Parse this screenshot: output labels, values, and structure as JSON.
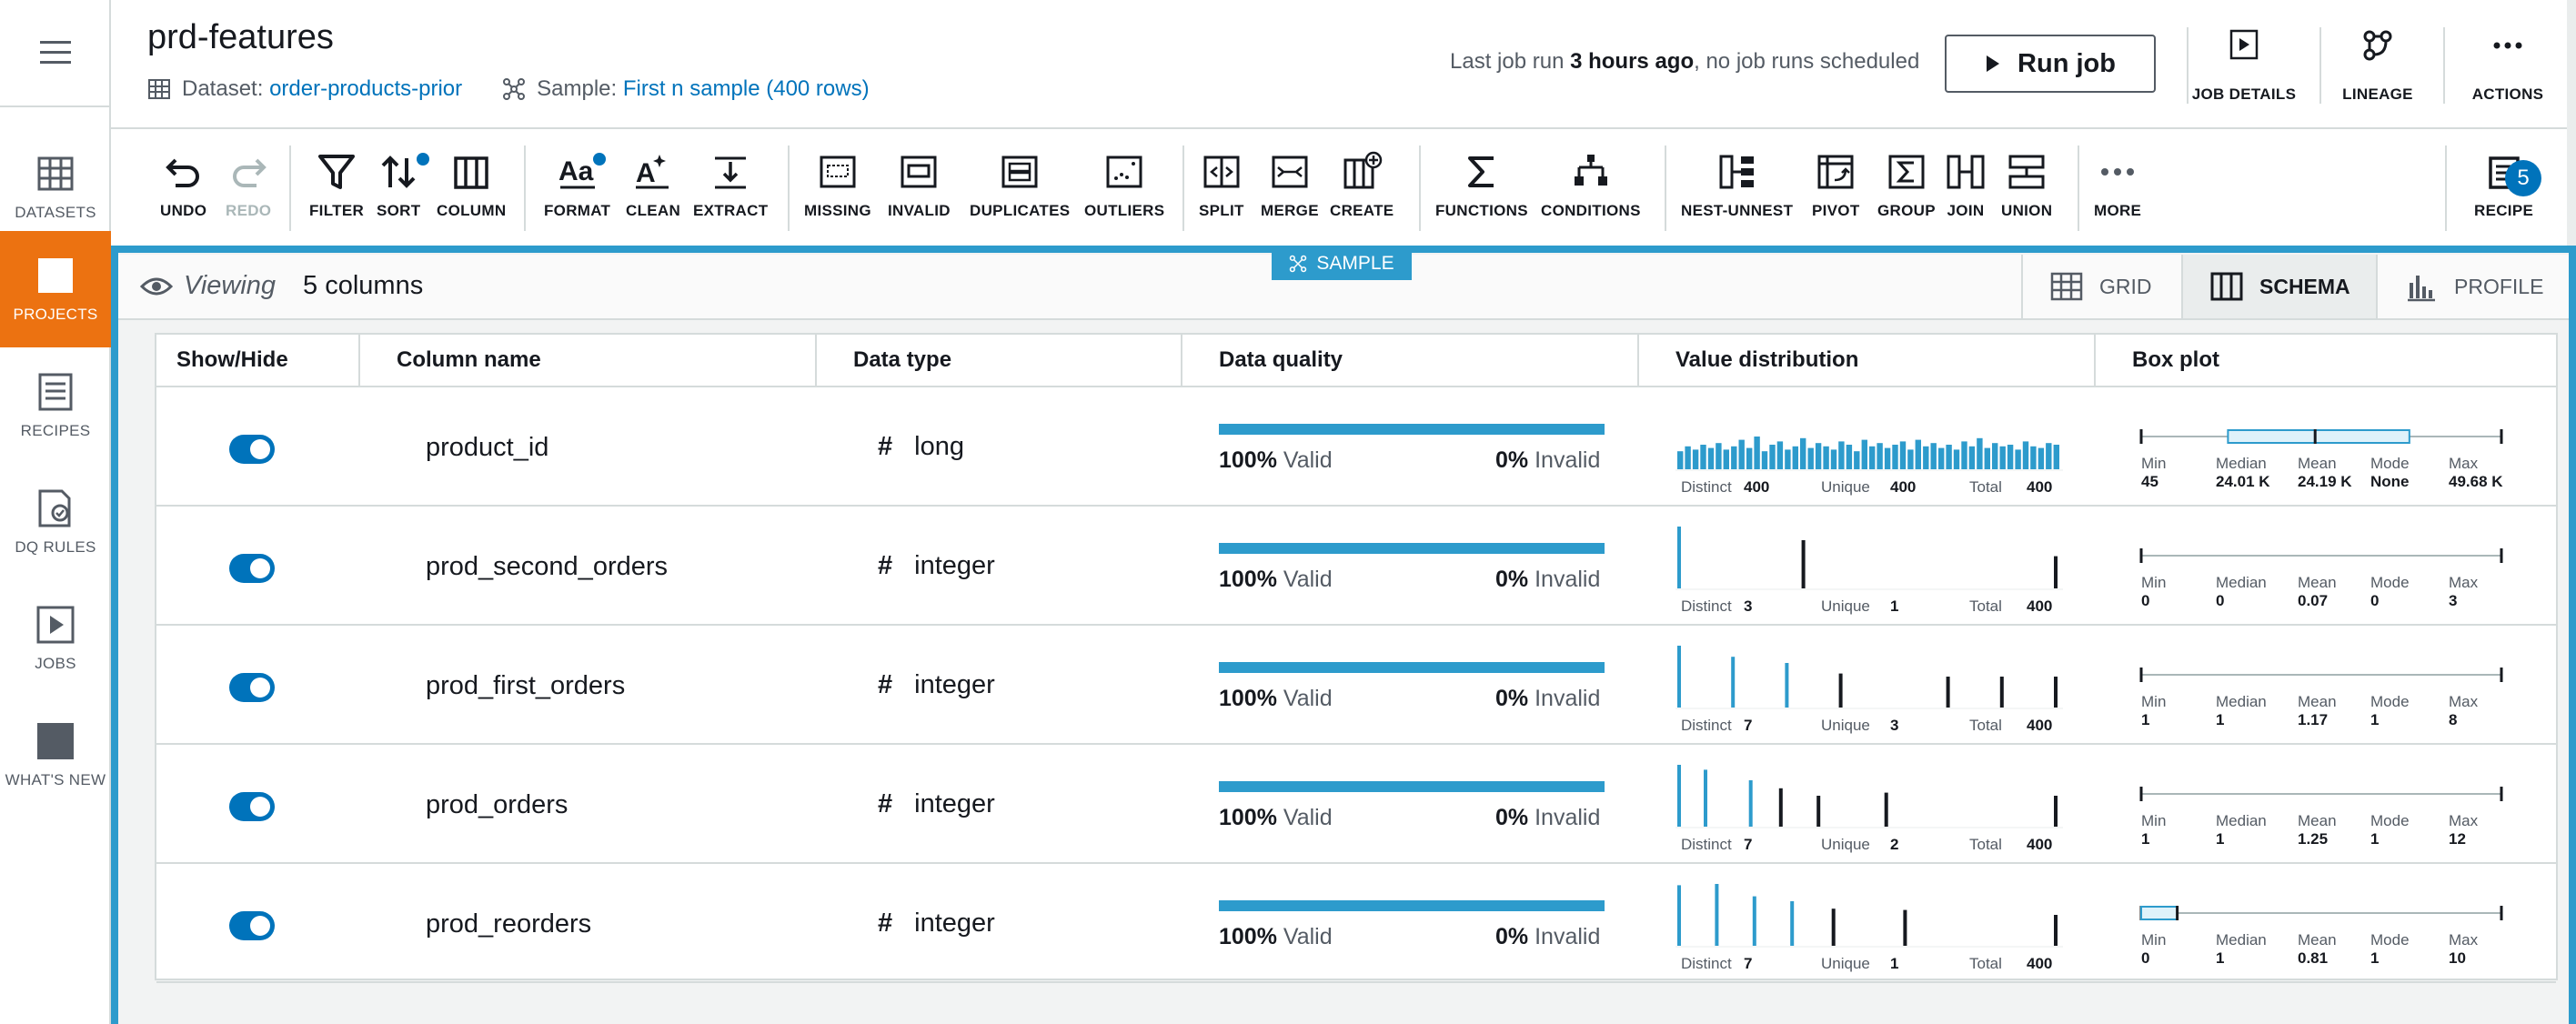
{
  "nav": {
    "items": [
      {
        "label": "DATASETS",
        "icon": "dataset-table-icon"
      },
      {
        "label": "PROJECTS",
        "icon": "projects-square-icon",
        "active": true
      },
      {
        "label": "RECIPES",
        "icon": "recipe-list-icon"
      },
      {
        "label": "DQ RULES",
        "icon": "dq-rules-icon"
      },
      {
        "label": "JOBS",
        "icon": "jobs-play-icon"
      },
      {
        "label": "WHAT'S NEW",
        "icon": "whats-new-icon"
      }
    ]
  },
  "header": {
    "title": "prd-features",
    "dataset_prefix": "Dataset: ",
    "dataset_name": "order-products-prior",
    "sample_prefix": "Sample: ",
    "sample_name": "First n sample (400 rows)",
    "last_job_pre": "Last job run ",
    "last_job_bold": "3 hours ago",
    "last_job_post": ", no job runs scheduled",
    "run_job": "Run job",
    "job_details": "JOB DETAILS",
    "lineage": "LINEAGE",
    "actions": "ACTIONS"
  },
  "toolbar": {
    "undo": "UNDO",
    "redo": "REDO",
    "filter": "FILTER",
    "sort": "SORT",
    "column": "COLUMN",
    "format": "FORMAT",
    "clean": "CLEAN",
    "extract": "EXTRACT",
    "missing": "MISSING",
    "invalid": "INVALID",
    "duplicates": "DUPLICATES",
    "outliers": "OUTLIERS",
    "split": "SPLIT",
    "merge": "MERGE",
    "create": "CREATE",
    "functions": "FUNCTIONS",
    "conditions": "CONDITIONS",
    "nest_unnest": "NEST-UNNEST",
    "pivot": "PIVOT",
    "group": "GROUP",
    "join": "JOIN",
    "union": "UNION",
    "more": "MORE",
    "recipe": "RECIPE",
    "recipe_count": "5"
  },
  "view": {
    "sample_badge": "SAMPLE",
    "viewing_label": "Viewing",
    "columns_count": "5 columns",
    "tabs": {
      "grid": "GRID",
      "schema": "SCHEMA",
      "profile": "PROFILE"
    },
    "active_tab": "SCHEMA"
  },
  "table": {
    "headers": [
      "Show/Hide",
      "Column name",
      "Data type",
      "Data quality",
      "Value distribution",
      "Box plot"
    ],
    "stat_labels": {
      "distinct": "Distinct",
      "unique": "Unique",
      "total": "Total"
    },
    "box_labels": {
      "min": "Min",
      "median": "Median",
      "mean": "Mean",
      "mode": "Mode",
      "max": "Max"
    },
    "quality_words": {
      "valid": "Valid",
      "invalid": "Invalid"
    },
    "rows": [
      {
        "visible": true,
        "name": "product_id",
        "type_symbol": "#",
        "type": "long",
        "valid_pct": "100%",
        "invalid_pct": "0%",
        "distinct": "400",
        "unique": "400",
        "total": "400",
        "min": "45",
        "median": "24.01 K",
        "mean": "24.19 K",
        "mode": "None",
        "max": "49.68 K",
        "box": {
          "min": 45,
          "q1": 12000,
          "median": 24010,
          "q3": 37000,
          "max": 49680
        },
        "dist_style": "uniform",
        "dist_values": [
          0.55,
          0.7,
          0.6,
          0.75,
          0.65,
          0.8,
          0.6,
          0.7,
          0.9,
          0.65,
          1.0,
          0.55,
          0.75,
          0.85,
          0.6,
          0.7,
          0.95,
          0.65,
          0.8,
          0.7,
          0.6,
          0.85,
          0.75,
          0.55,
          0.9,
          0.7,
          0.8,
          0.65,
          0.75,
          0.85,
          0.6,
          0.9,
          0.7,
          0.8,
          0.65,
          0.75,
          0.6,
          0.85,
          0.7,
          0.95,
          0.65,
          0.8,
          0.7,
          0.75,
          0.6,
          0.85,
          0.7,
          0.65,
          0.8,
          0.75
        ]
      },
      {
        "visible": true,
        "name": "prod_second_orders",
        "type_symbol": "#",
        "type": "integer",
        "valid_pct": "100%",
        "invalid_pct": "0%",
        "distinct": "3",
        "unique": "1",
        "total": "400",
        "min": "0",
        "median": "0",
        "mean": "0.07",
        "mode": "0",
        "max": "3",
        "box": {
          "min": 0,
          "q1": 0,
          "median": 0,
          "q3": 0,
          "max": 3
        },
        "dist_style": "bars",
        "dist_bars": [
          {
            "x": 0.0,
            "h": 1.0,
            "c": "#2d9bcc"
          },
          {
            "x": 0.33,
            "h": 0.78,
            "c": "#16191f"
          },
          {
            "x": 1.0,
            "h": 0.52,
            "c": "#16191f"
          }
        ]
      },
      {
        "visible": true,
        "name": "prod_first_orders",
        "type_symbol": "#",
        "type": "integer",
        "valid_pct": "100%",
        "invalid_pct": "0%",
        "distinct": "7",
        "unique": "3",
        "total": "400",
        "min": "1",
        "median": "1",
        "mean": "1.17",
        "mode": "1",
        "max": "8",
        "box": {
          "min": 1,
          "q1": 1,
          "median": 1,
          "q3": 1,
          "max": 8
        },
        "dist_style": "bars",
        "dist_bars": [
          {
            "x": 0.0,
            "h": 1.0,
            "c": "#2d9bcc"
          },
          {
            "x": 0.143,
            "h": 0.82,
            "c": "#2d9bcc"
          },
          {
            "x": 0.286,
            "h": 0.72,
            "c": "#2d9bcc"
          },
          {
            "x": 0.429,
            "h": 0.55,
            "c": "#16191f"
          },
          {
            "x": 0.714,
            "h": 0.5,
            "c": "#16191f"
          },
          {
            "x": 0.857,
            "h": 0.5,
            "c": "#16191f"
          },
          {
            "x": 1.0,
            "h": 0.5,
            "c": "#16191f"
          }
        ]
      },
      {
        "visible": true,
        "name": "prod_orders",
        "type_symbol": "#",
        "type": "integer",
        "valid_pct": "100%",
        "invalid_pct": "0%",
        "distinct": "7",
        "unique": "2",
        "total": "400",
        "min": "1",
        "median": "1",
        "mean": "1.25",
        "mode": "1",
        "max": "12",
        "box": {
          "min": 1,
          "q1": 1,
          "median": 1,
          "q3": 1,
          "max": 12
        },
        "dist_style": "bars",
        "dist_bars": [
          {
            "x": 0.0,
            "h": 1.0,
            "c": "#2d9bcc"
          },
          {
            "x": 0.07,
            "h": 0.92,
            "c": "#2d9bcc"
          },
          {
            "x": 0.19,
            "h": 0.75,
            "c": "#2d9bcc"
          },
          {
            "x": 0.27,
            "h": 0.62,
            "c": "#16191f"
          },
          {
            "x": 0.37,
            "h": 0.5,
            "c": "#16191f"
          },
          {
            "x": 0.55,
            "h": 0.55,
            "c": "#16191f"
          },
          {
            "x": 1.0,
            "h": 0.5,
            "c": "#16191f"
          }
        ]
      },
      {
        "visible": true,
        "name": "prod_reorders",
        "type_symbol": "#",
        "type": "integer",
        "valid_pct": "100%",
        "invalid_pct": "0%",
        "distinct": "7",
        "unique": "1",
        "total": "400",
        "min": "0",
        "median": "1",
        "mean": "0.81",
        "mode": "1",
        "max": "10",
        "box": {
          "min": 0,
          "q1": 0,
          "median": 1,
          "q3": 1,
          "max": 10
        },
        "dist_style": "bars",
        "dist_bars": [
          {
            "x": 0.0,
            "h": 0.98,
            "c": "#2d9bcc"
          },
          {
            "x": 0.1,
            "h": 1.0,
            "c": "#2d9bcc"
          },
          {
            "x": 0.2,
            "h": 0.8,
            "c": "#2d9bcc"
          },
          {
            "x": 0.3,
            "h": 0.72,
            "c": "#2d9bcc"
          },
          {
            "x": 0.41,
            "h": 0.6,
            "c": "#16191f"
          },
          {
            "x": 0.6,
            "h": 0.58,
            "c": "#16191f"
          },
          {
            "x": 1.0,
            "h": 0.5,
            "c": "#16191f"
          }
        ]
      }
    ]
  },
  "colors": {
    "accent": "#ec7211",
    "blue": "#0073bb",
    "bar": "#2d9bcc"
  }
}
